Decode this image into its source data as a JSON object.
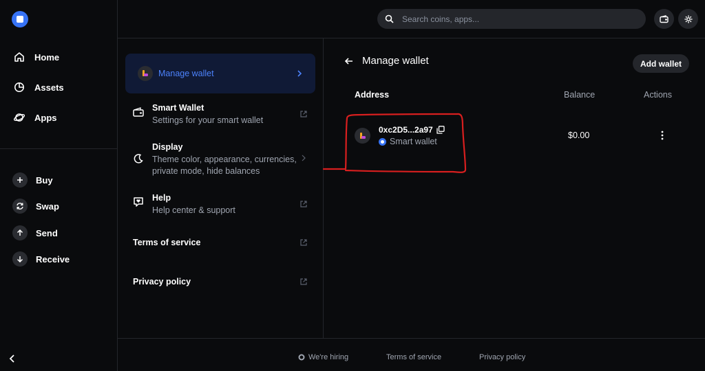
{
  "nav": {
    "items": [
      {
        "label": "Home",
        "icon": "home-icon"
      },
      {
        "label": "Assets",
        "icon": "pie-chart-icon"
      },
      {
        "label": "Apps",
        "icon": "planet-icon"
      }
    ],
    "actions": [
      {
        "label": "Buy",
        "icon": "plus-icon"
      },
      {
        "label": "Swap",
        "icon": "swap-icon"
      },
      {
        "label": "Send",
        "icon": "arrow-up-icon"
      },
      {
        "label": "Receive",
        "icon": "arrow-down-icon"
      }
    ]
  },
  "search": {
    "placeholder": "Search coins, apps..."
  },
  "settings": {
    "manage_wallet": "Manage wallet",
    "smart_wallet": {
      "title": "Smart Wallet",
      "desc": "Settings for your smart wallet"
    },
    "display": {
      "title": "Display",
      "desc": "Theme color, appearance, currencies, private mode, hide balances"
    },
    "help": {
      "title": "Help",
      "desc": "Help center & support"
    },
    "terms": "Terms of service",
    "privacy": "Privacy policy"
  },
  "main": {
    "title": "Manage wallet",
    "add_wallet": "Add wallet",
    "columns": {
      "address": "Address",
      "balance": "Balance",
      "actions": "Actions"
    },
    "wallets": [
      {
        "address": "0xc2D5...2a97",
        "type": "Smart wallet",
        "balance": "$0.00"
      }
    ]
  },
  "footer": {
    "hiring": "We're hiring",
    "terms": "Terms of service",
    "privacy": "Privacy policy"
  },
  "colors": {
    "accent": "#3773f5",
    "annotation": "#d91f1f",
    "background": "#0a0b0d"
  }
}
